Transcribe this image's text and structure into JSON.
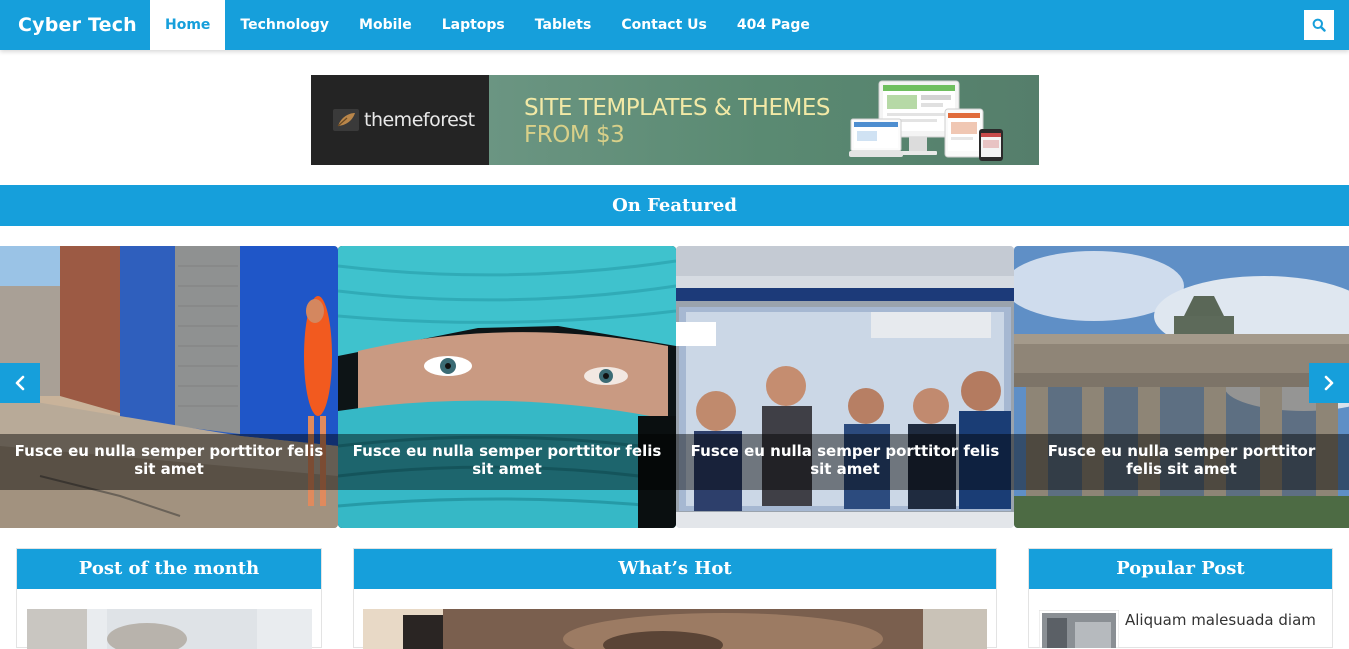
{
  "nav": {
    "brand": "Cyber Tech",
    "items": [
      {
        "label": "Home",
        "active": true
      },
      {
        "label": "Technology",
        "active": false
      },
      {
        "label": "Mobile",
        "active": false
      },
      {
        "label": "Laptops",
        "active": false
      },
      {
        "label": "Tablets",
        "active": false
      },
      {
        "label": "Contact Us",
        "active": false
      },
      {
        "label": "404 Page",
        "active": false
      }
    ],
    "search_icon": "search-icon"
  },
  "banner": {
    "logo_text": "themeforest",
    "line1": "SITE TEMPLATES & THEMES",
    "line2": "FROM $3"
  },
  "featured": {
    "title": "On Featured",
    "slides": [
      {
        "caption": "Fusce eu nulla semper porttitor felis sit amet"
      },
      {
        "caption": "Fusce eu nulla semper porttitor felis sit amet"
      },
      {
        "caption": "Fusce eu nulla semper porttitor felis sit amet"
      },
      {
        "caption": "Fusce eu nulla semper porttitor felis sit amet"
      }
    ],
    "prev_icon": "chevron-left-icon",
    "next_icon": "chevron-right-icon"
  },
  "widgets": {
    "post_of_month": {
      "title": "Post of the month"
    },
    "whats_hot": {
      "title": "What’s Hot"
    },
    "popular": {
      "title": "Popular Post",
      "first_item": "Aliquam malesuada diam"
    }
  },
  "colors": {
    "accent": "#169fdb",
    "text": "#333333"
  }
}
